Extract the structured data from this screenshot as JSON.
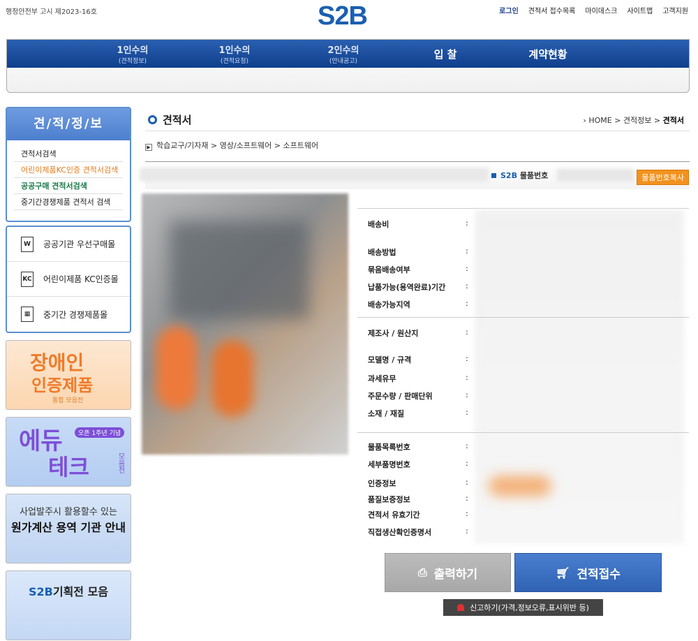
{
  "header": {
    "notice": "행정안전부 고시 제2023-16호",
    "logo": "S2B",
    "topnav": [
      "로그인",
      "견적서 접수목록",
      "마이데스크",
      "사이트맵",
      "고객지원"
    ]
  },
  "gnb": [
    {
      "main": "1인수의",
      "sub": "(견적정보)"
    },
    {
      "main": "1인수의",
      "sub": "(견적요청)"
    },
    {
      "main": "2인수의",
      "sub": "(안내공고)"
    },
    {
      "main": "입 찰",
      "sub": ""
    },
    {
      "main": "계약현황",
      "sub": ""
    }
  ],
  "lnb": {
    "title": "견/적/정/보",
    "items": [
      "견적서검색",
      "어린이제품KC인증 견적서검색",
      "공공구매 견적서검색",
      "중기간경쟁제품 견적서 검색"
    ]
  },
  "quick": [
    {
      "icon": "W",
      "label": "공공기관 우선구매몰"
    },
    {
      "icon": "KC",
      "label": "어린이제품 KC인증몰"
    },
    {
      "icon": "▦",
      "label": "중기간 경쟁제품몰"
    }
  ],
  "banners": {
    "b1": {
      "line1": "장애인",
      "line2": "인증제품",
      "line3": "통합 모음전"
    },
    "b2": {
      "line1": "에듀",
      "line2": "테크",
      "badge": "오픈 1주년 기념",
      "side": "모음전"
    },
    "b3": {
      "line1": "사업발주시 활용할수 있는",
      "line2": "원가계산 용역 기관 안내"
    },
    "b4": {
      "brand": "S2B",
      "text": "기획전 모음"
    }
  },
  "page": {
    "title": "견적서",
    "breadcrumb": [
      "HOME",
      "견적정보",
      "견적서"
    ],
    "category": "학습교구/기자재 > 영상/소프트웨어 > 소프트웨어",
    "product_number_brand": "S2B",
    "product_number_label": "물품번호",
    "copy_button": "물품번호복사"
  },
  "spec": {
    "groups": [
      [
        "배송비",
        "배송방법",
        "묶음배송여부",
        "납품가능(용역완료)기간",
        "배송가능지역"
      ],
      [
        "제조사 / 원산지",
        "모델명 / 규격",
        "과세유무",
        "주문수량 / 판매단위",
        "소재 / 재질"
      ],
      [
        "물품목록번호",
        "세부품명번호",
        "인증정보",
        "품질보증정보",
        "견적서 유효기간",
        "직접생산확인증명서"
      ]
    ],
    "colon": ":"
  },
  "actions": {
    "print": "출력하기",
    "quote": "견적접수",
    "report": "신고하기(가격,정보오류,표시위반 등)"
  },
  "colors": {
    "brand": "#1a5fb0",
    "accent": "#f3921e",
    "nav": "#0f3f8c"
  }
}
